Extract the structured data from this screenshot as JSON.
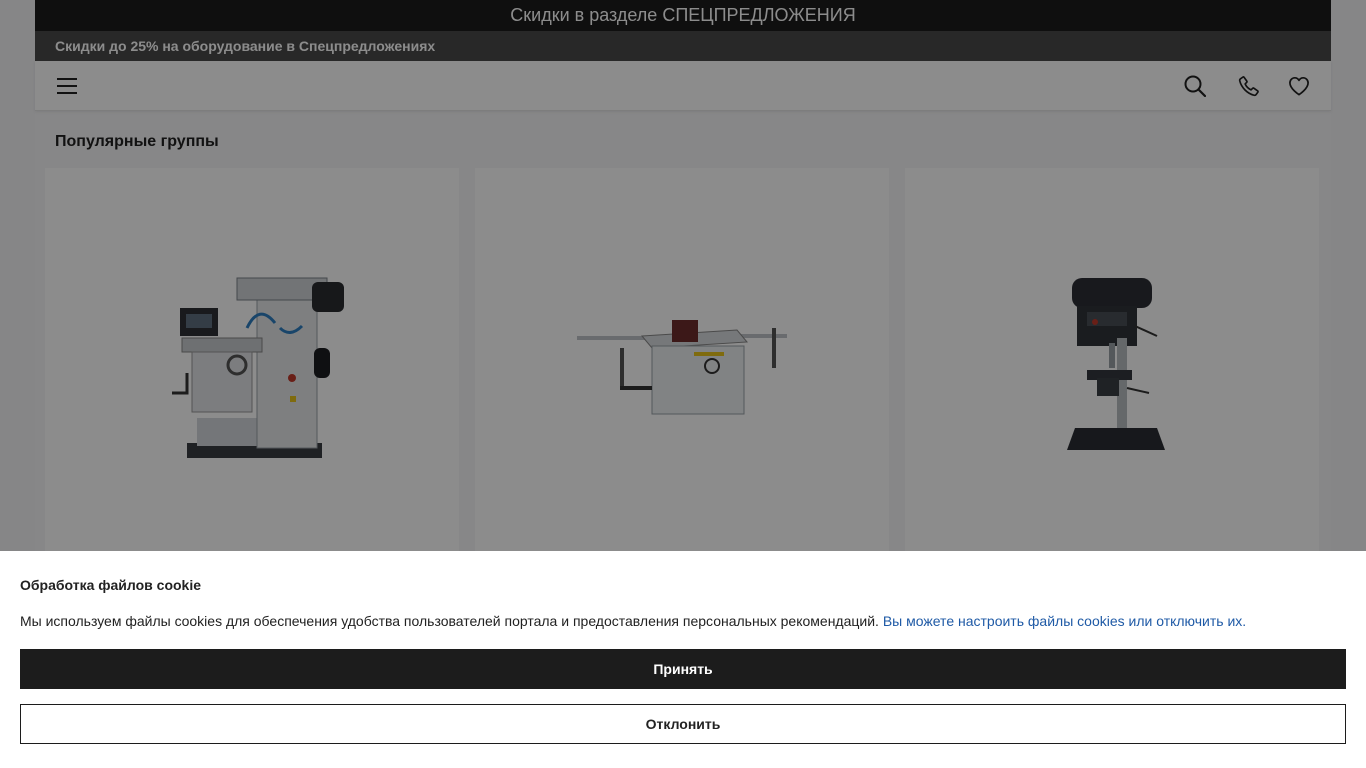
{
  "promo": {
    "text": "Скидки в разделе СПЕЦПРЕДЛОЖЕНИЯ"
  },
  "sub_banner": {
    "text": "Скидки до 25% на оборудование в Спецпредложениях"
  },
  "header": {
    "menu_icon": "hamburger-menu-icon",
    "search_icon": "search-icon",
    "phone_icon": "phone-icon",
    "favorites_icon": "heart-icon"
  },
  "popular": {
    "title": "Популярные группы",
    "groups": [
      {
        "image": "milling-machine"
      },
      {
        "image": "table-saw"
      },
      {
        "image": "drill-press"
      }
    ]
  },
  "cookie": {
    "title": "Обработка файлов cookie",
    "text": "Мы используем файлы cookies для обеспечения удобства пользователей портала и предоставления персональных рекомендаций.",
    "link": "Вы можете настроить файлы cookies или отключить их.",
    "accept_label": "Принять",
    "decline_label": "Отклонить"
  },
  "colors": {
    "dark": "#1c1c1c",
    "link": "#1f5aa6",
    "overlay": "rgba(0,0,0,0.45)"
  }
}
